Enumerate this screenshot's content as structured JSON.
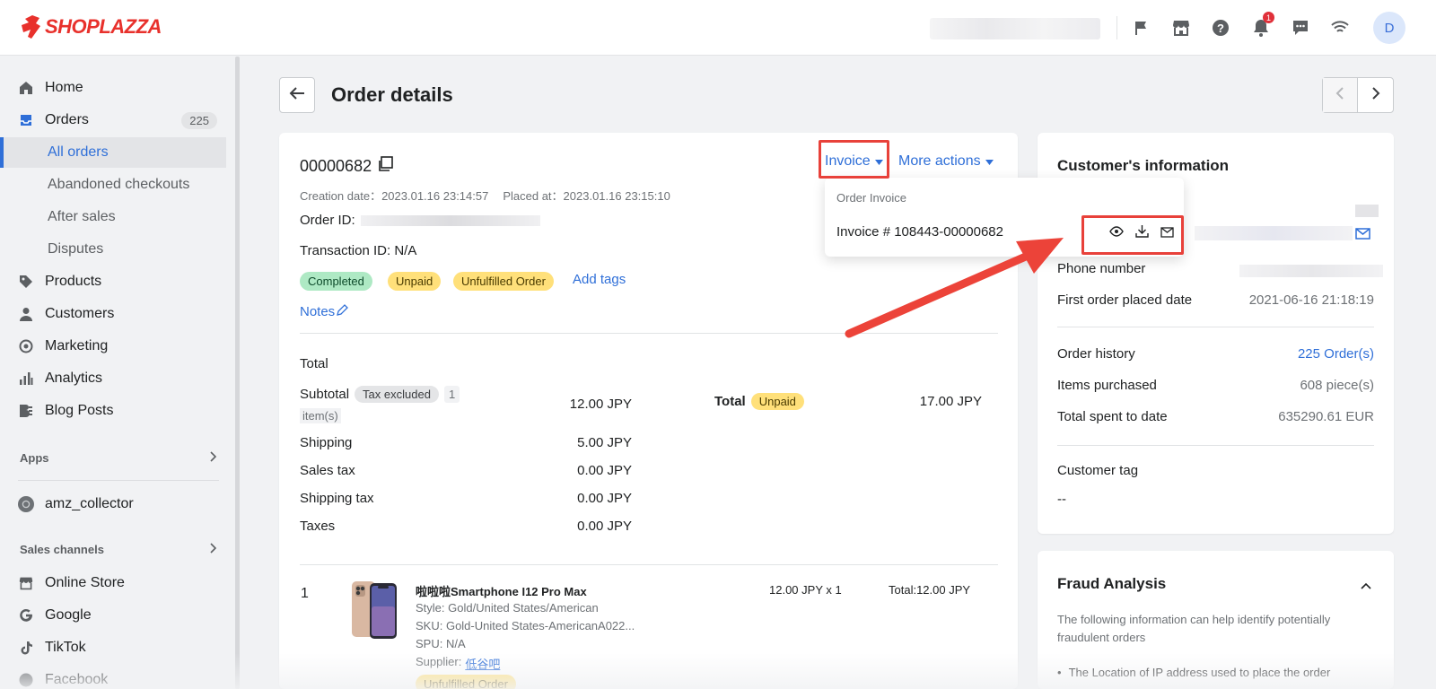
{
  "brand": {
    "name": "SHOPLAZZA",
    "color": "#e8312c"
  },
  "topbar": {
    "notification_count": "1",
    "avatar_initial": "D",
    "icons": [
      "flag-icon",
      "store-icon",
      "help-icon",
      "bell-icon",
      "chat-icon",
      "wifi-icon"
    ]
  },
  "sidebar": {
    "home": "Home",
    "orders": "Orders",
    "orders_count": "225",
    "all_orders": "All orders",
    "abandoned": "Abandoned checkouts",
    "after_sales": "After sales",
    "disputes": "Disputes",
    "products": "Products",
    "customers": "Customers",
    "marketing": "Marketing",
    "analytics": "Analytics",
    "blog": "Blog Posts",
    "apps_title": "Apps",
    "app_item": "amz_collector",
    "sales_channels_title": "Sales channels",
    "online_store": "Online Store",
    "google": "Google",
    "tiktok": "TikTok",
    "facebook": "Facebook"
  },
  "header": {
    "title": "Order details"
  },
  "order": {
    "number": "00000682",
    "invoice_label": "Invoice",
    "more_actions": "More actions",
    "creation_label": "Creation date：",
    "creation_date": "2023.01.16 23:14:57",
    "placed_label": "Placed at：",
    "placed_date": "2023.01.16 23:15:10",
    "order_id_label": "Order ID:",
    "transaction_id": "Transaction ID: N/A",
    "tags": {
      "completed": "Completed",
      "unpaid": "Unpaid",
      "unfulfilled": "Unfulfilled Order"
    },
    "add_tags": "Add tags",
    "notes": "Notes",
    "total_heading": "Total",
    "subtotal_label": "Subtotal",
    "tax_excluded": "Tax excluded",
    "items_count": "1",
    "items_unit": "item(s)",
    "subtotal": "12.00 JPY",
    "shipping_label": "Shipping",
    "shipping": "5.00 JPY",
    "sales_tax_label": "Sales tax",
    "sales_tax": "0.00 JPY",
    "shipping_tax_label": "Shipping tax",
    "shipping_tax": "0.00 JPY",
    "taxes_label": "Taxes",
    "taxes": "0.00 JPY",
    "total_label": "Total",
    "total_status": "Unpaid",
    "total": "17.00 JPY"
  },
  "invoice_dropdown": {
    "heading": "Order Invoice",
    "invoice_number": "Invoice # 108443-00000682"
  },
  "line_item": {
    "index": "1",
    "title": "啦啦啦Smartphone I12 Pro Max",
    "style": "Style: Gold/United States/American",
    "sku": "SKU: Gold-United States-AmericanA022...",
    "spu": "SPU: N/A",
    "supplier_label": "Supplier:",
    "supplier": "低谷吧",
    "price_qty": "12.00 JPY x 1",
    "line_total": "Total:12.00 JPY",
    "status": "Unfulfilled Order"
  },
  "customer": {
    "title": "Customer's information",
    "phone_label": "Phone number",
    "first_order_label": "First order placed date",
    "first_order_date": "2021-06-16 21:18:19",
    "order_history_label": "Order history",
    "order_history": "225 Order(s)",
    "items_purchased_label": "Items purchased",
    "items_purchased": "608 piece(s)",
    "total_spent_label": "Total spent to date",
    "total_spent": "635290.61 EUR",
    "tag_label": "Customer tag",
    "tag_value": "--"
  },
  "fraud": {
    "title": "Fraud Analysis",
    "description": "The following information can help identify potentially fraudulent orders",
    "bullet": "The Location of IP address used to place the order"
  }
}
